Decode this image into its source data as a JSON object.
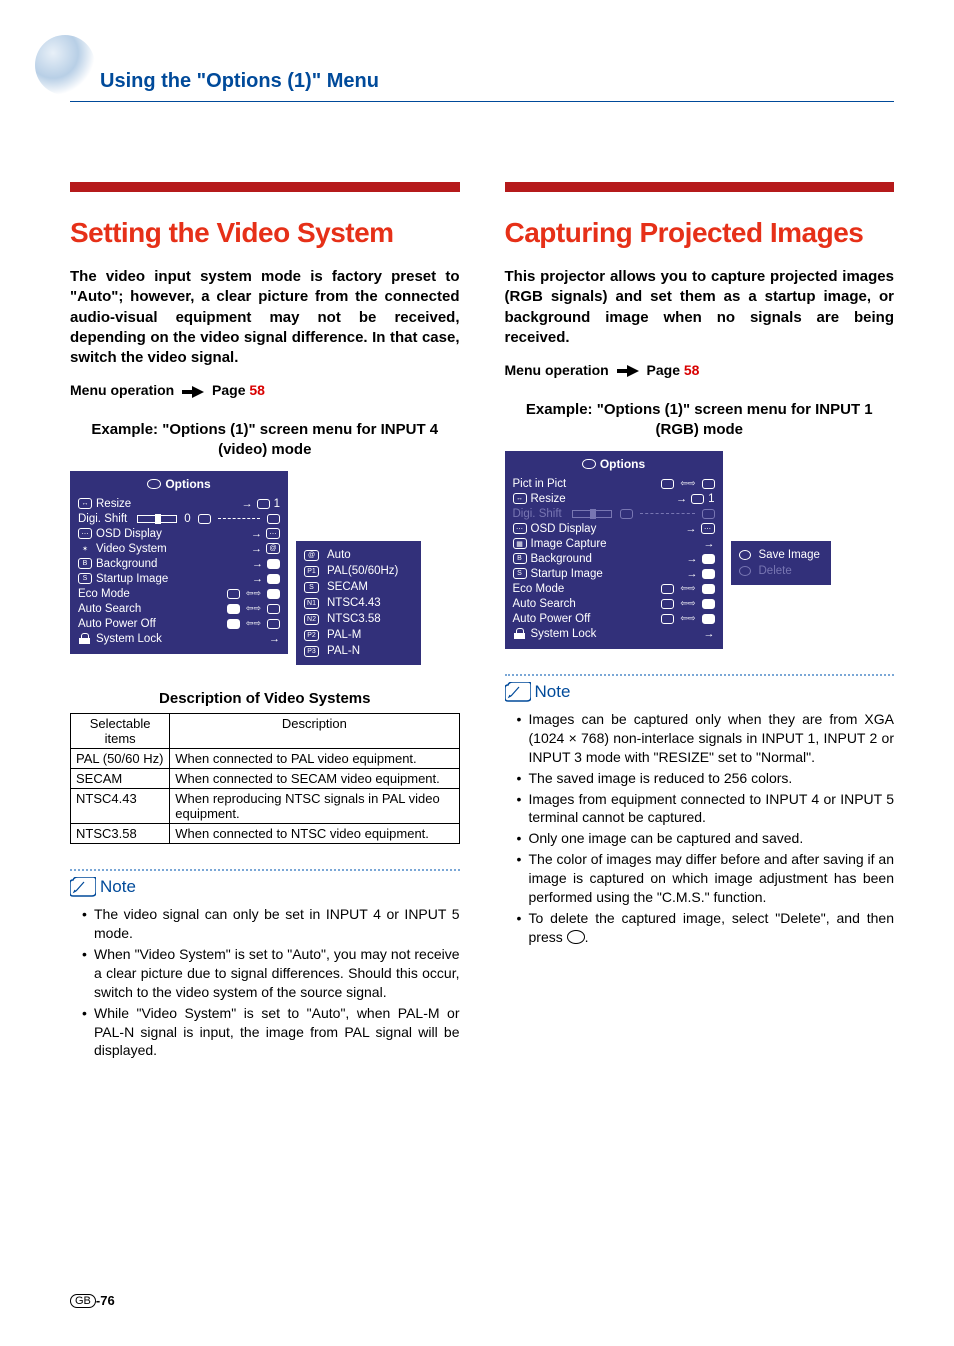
{
  "header": {
    "title": "Using the \"Options (1)\" Menu"
  },
  "left": {
    "heading": "Setting the Video System",
    "lead": "The video input system mode is factory preset to \"Auto\"; however, a clear picture from the connected audio-visual equipment may not be received, depending on the video signal difference. In that case, switch the video signal.",
    "menuop_label": "Menu operation",
    "menuop_page_label": "Page",
    "menuop_page": "58",
    "example": "Example: \"Options (1)\" screen menu for INPUT 4 (video) mode",
    "osd": {
      "title": "Options",
      "items": [
        "Resize",
        "Digi. Shift",
        "OSD Display",
        "Video System",
        "Background",
        "Startup Image",
        "Eco Mode",
        "Auto Search",
        "Auto Power Off",
        "System Lock"
      ]
    },
    "submenu": {
      "items": [
        {
          "code": "",
          "label": "Auto"
        },
        {
          "code": "P1",
          "label": "PAL(50/60Hz)"
        },
        {
          "code": "S",
          "label": "SECAM"
        },
        {
          "code": "N1",
          "label": "NTSC4.43"
        },
        {
          "code": "N2",
          "label": "NTSC3.58"
        },
        {
          "code": "P2",
          "label": "PAL-M"
        },
        {
          "code": "P3",
          "label": "PAL-N"
        }
      ]
    },
    "table": {
      "caption": "Description of Video Systems",
      "head": [
        "Selectable items",
        "Description"
      ],
      "rows": [
        [
          "PAL (50/60 Hz)",
          "When connected to PAL video equipment."
        ],
        [
          "SECAM",
          "When connected to SECAM video equipment."
        ],
        [
          "NTSC4.43",
          "When reproducing NTSC signals in PAL video equipment."
        ],
        [
          "NTSC3.58",
          "When connected to NTSC video equipment."
        ]
      ]
    },
    "note_label": "Note",
    "notes": [
      "The video signal can only be set in INPUT 4 or INPUT 5 mode.",
      "When \"Video System\" is set to \"Auto\", you may not receive a clear picture due to signal differences. Should this occur, switch to the video system of the source signal.",
      "While \"Video System\" is set to \"Auto\", when PAL-M or PAL-N signal is input, the image from PAL signal will be displayed."
    ]
  },
  "right": {
    "heading": "Capturing Projected Images",
    "lead": "This projector allows you to capture projected images (RGB signals) and set them as a startup image, or background image when no signals are being received.",
    "menuop_label": "Menu operation",
    "menuop_page_label": "Page",
    "menuop_page": "58",
    "example": "Example: \"Options (1)\" screen menu for INPUT 1 (RGB) mode",
    "osd": {
      "title": "Options",
      "items": [
        "Pict in Pict",
        "Resize",
        "Digi. Shift",
        "OSD Display",
        "Image Capture",
        "Background",
        "Startup Image",
        "Eco Mode",
        "Auto Search",
        "Auto Power Off",
        "System Lock"
      ]
    },
    "submenu": {
      "save": "Save Image",
      "delete": "Delete"
    },
    "note_label": "Note",
    "notes": [
      "Images can be captured only when they are from XGA (1024 × 768) non-interlace signals in INPUT 1, INPUT 2 or INPUT 3 mode with \"RESIZE\" set to \"Normal\".",
      "The saved image is reduced to 256 colors.",
      "Images from equipment connected to INPUT 4 or INPUT 5 terminal cannot be captured.",
      "Only one image can be captured and saved.",
      "The color of images may differ before and after saving if an image is captured on which image adjustment has been performed using the \"C.M.S.\" function."
    ],
    "note_last_a": "To delete the captured image, select \"Delete\", and then press ",
    "note_last_b": "."
  },
  "footer": {
    "region": "GB",
    "page": "-76"
  }
}
